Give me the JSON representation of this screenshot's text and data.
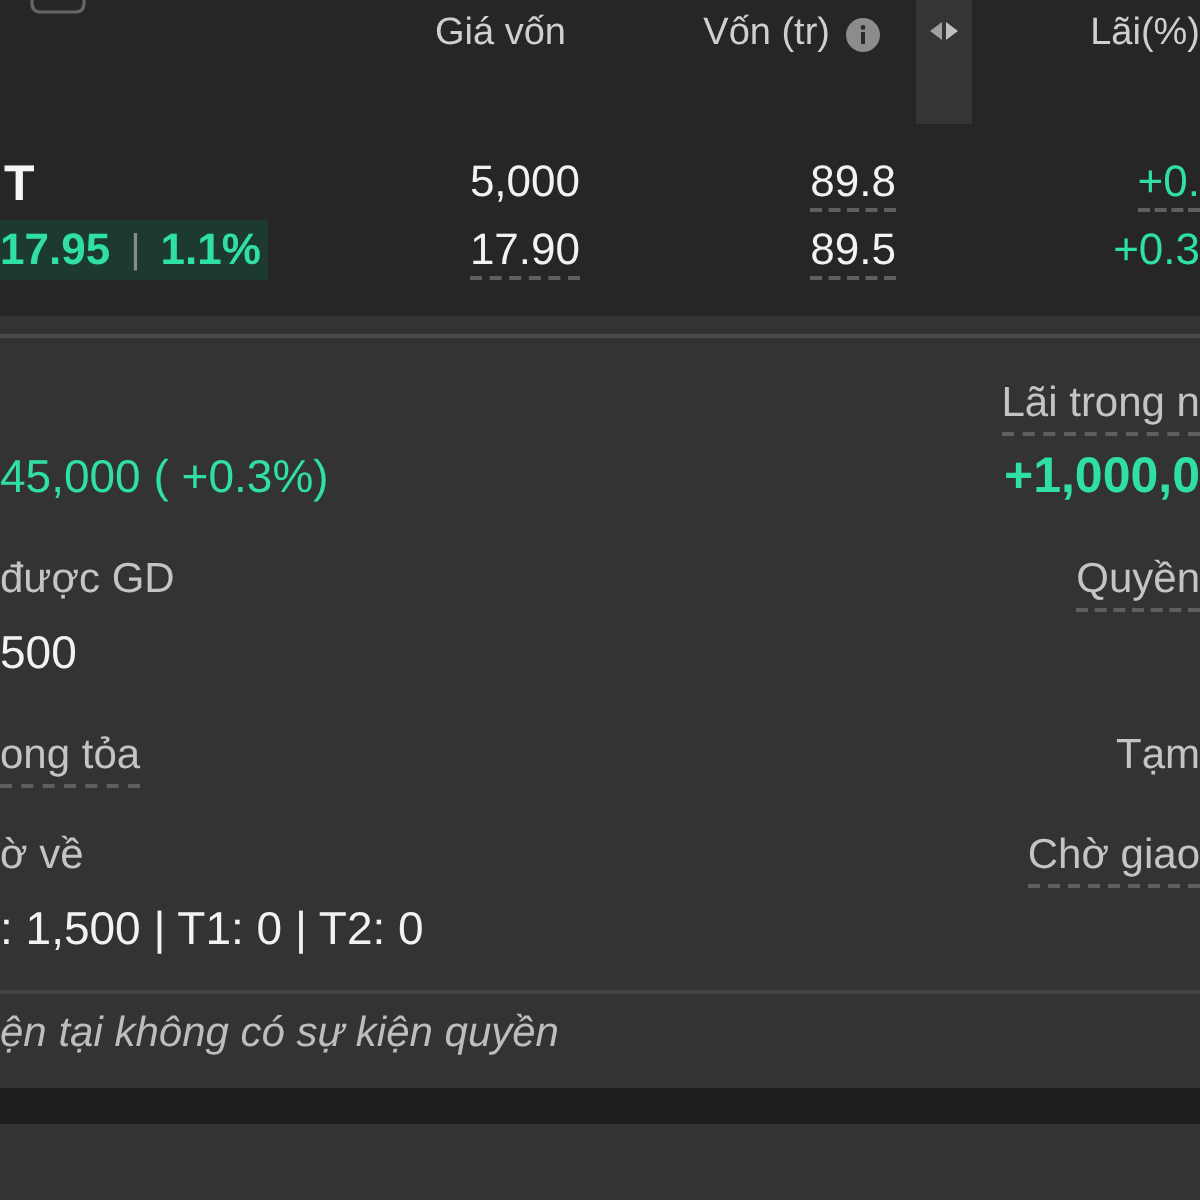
{
  "header": {
    "columns": [
      {
        "label": "Giá vốn",
        "info": false
      },
      {
        "label": "Vốn (tr)",
        "info": true
      },
      {
        "label": "Lãi(%)",
        "info": false
      }
    ]
  },
  "holding": {
    "ticker": "T",
    "quote": {
      "price": "17.95",
      "separator": "|",
      "change": "1.1%",
      "gain": true
    },
    "lines": [
      {
        "cells": [
          {
            "text": "5,000",
            "underlined": false,
            "gain": false
          },
          {
            "text": "89.8",
            "underlined": true,
            "gain": false
          },
          {
            "text": "+0.",
            "underlined": true,
            "gain": true
          }
        ]
      },
      {
        "cells": [
          {
            "text": "17.90",
            "underlined": true,
            "gain": false
          },
          {
            "text": "89.5",
            "underlined": true,
            "gain": false
          },
          {
            "text": "+0.3",
            "underlined": false,
            "gain": true
          }
        ]
      }
    ]
  },
  "details": {
    "rows": [
      {
        "left": {
          "value": "45,000 ( +0.3%)",
          "gain": true,
          "emphasized": false
        },
        "right": {
          "label": "Lãi trong n",
          "underlined": true,
          "value": "+1,000,0",
          "gain": true,
          "emphasized": true
        }
      },
      {
        "left": {
          "label": "được GD",
          "underlined": false,
          "value": "500",
          "gain": false,
          "emphasized": false
        },
        "right": {
          "label": "Quyền",
          "underlined": true
        }
      },
      {
        "left": {
          "label": "ong tỏa",
          "underlined": true
        },
        "right": {
          "label": "Tạm",
          "underlined": false
        }
      },
      {
        "left": {
          "label": "ờ về",
          "underlined": false,
          "value": ": 1,500 | T1: 0 | T2: 0",
          "gain": false,
          "emphasized": false
        },
        "right": {
          "label": "Chờ giao",
          "underlined": true
        }
      }
    ]
  },
  "note": "ện tại không có sự kiện quyền"
}
